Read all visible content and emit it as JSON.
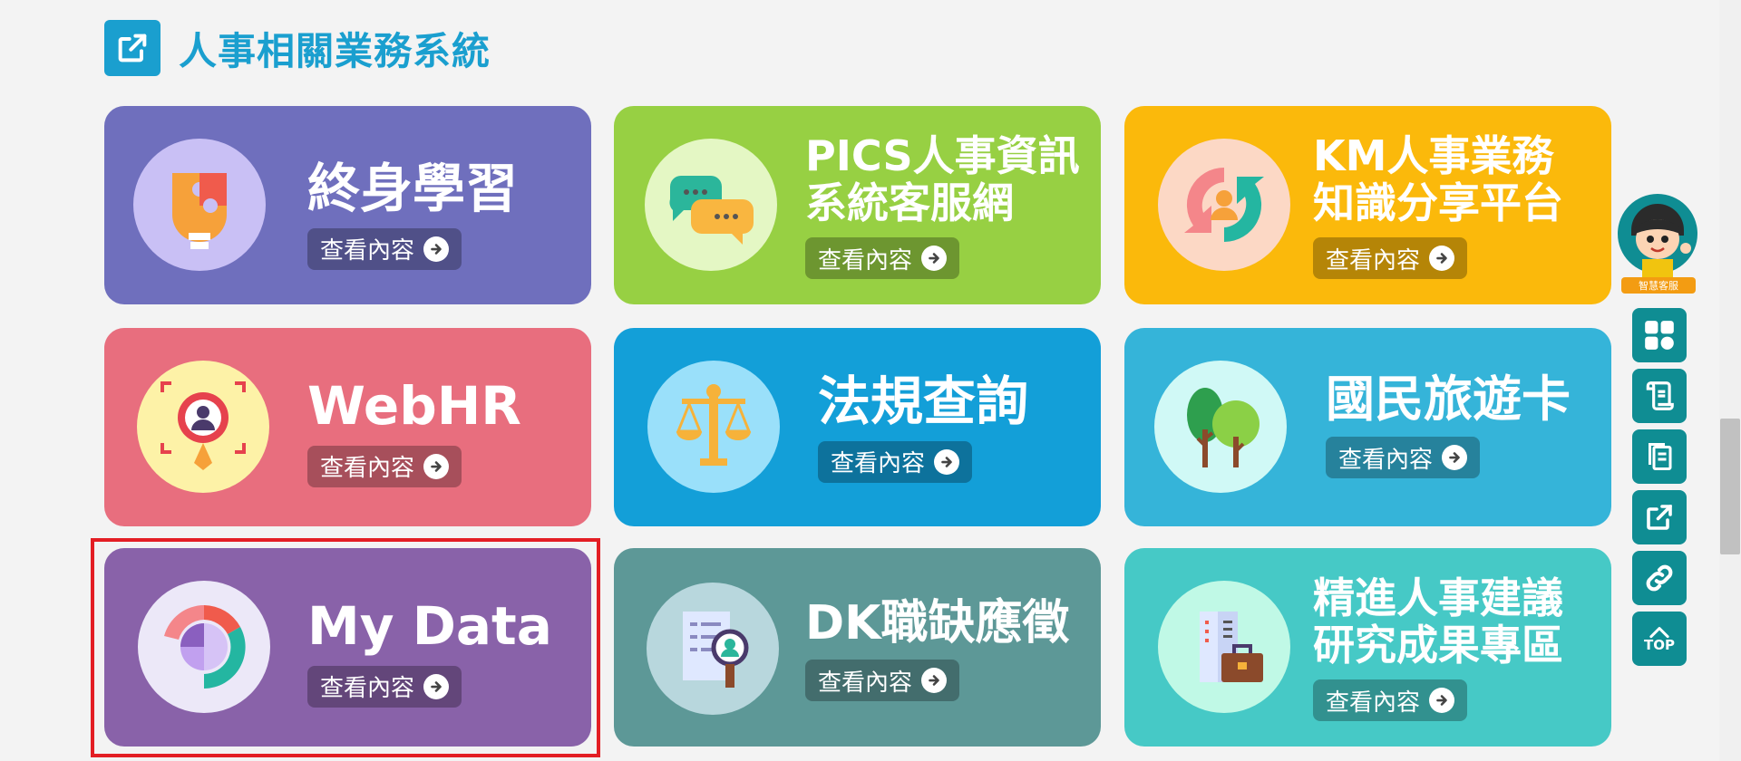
{
  "section": {
    "title": "人事相關業務系統",
    "icon": "external-link-icon"
  },
  "cards": [
    {
      "title_lines": [
        "終身學習"
      ],
      "button": "查看內容",
      "color": "#6f6fbd",
      "icon": "puzzle-lightbulb-icon"
    },
    {
      "title_lines": [
        "PICS人事資訊",
        "系統客服網"
      ],
      "button": "查看內容",
      "color": "#97d043",
      "icon": "chat-bubbles-icon"
    },
    {
      "title_lines": [
        "KM人事業務",
        "知識分享平台"
      ],
      "button": "查看內容",
      "color": "#fbb90b",
      "icon": "refresh-person-icon"
    },
    {
      "title_lines": [
        "WebHR"
      ],
      "button": "查看內容",
      "color": "#e86e7e",
      "icon": "target-person-icon"
    },
    {
      "title_lines": [
        "法規查詢"
      ],
      "button": "查看內容",
      "color": "#139fd8",
      "icon": "scales-icon"
    },
    {
      "title_lines": [
        "國民旅遊卡"
      ],
      "button": "查看內容",
      "color": "#35b4d9",
      "icon": "trees-icon"
    },
    {
      "title_lines": [
        "My Data"
      ],
      "button": "查看內容",
      "color": "#8962a9",
      "icon": "pie-chart-icon"
    },
    {
      "title_lines": [
        "DK職缺應徵"
      ],
      "button": "查看內容",
      "color": "#5d9897",
      "icon": "document-magnifier-icon"
    },
    {
      "title_lines": [
        "精進人事建議",
        "研究成果專區"
      ],
      "button": "查看內容",
      "color": "#46c9c6",
      "icon": "building-briefcase-icon"
    }
  ],
  "assistant": {
    "label": "智慧客服",
    "icon": "assistant-avatar-icon"
  },
  "rail": [
    {
      "icon": "grid-icon"
    },
    {
      "icon": "scroll-icon"
    },
    {
      "icon": "copy-icon"
    },
    {
      "icon": "external-link-icon"
    },
    {
      "icon": "link-icon"
    },
    {
      "icon": "chevron-up-icon",
      "label": "TOP"
    }
  ]
}
